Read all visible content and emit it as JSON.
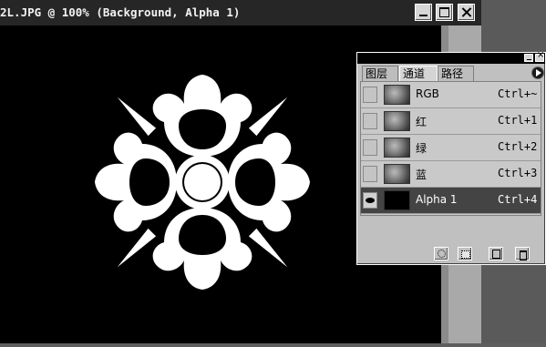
{
  "window": {
    "title": "2L.JPG @ 100% (Background, Alpha 1)"
  },
  "palette": {
    "tabs": [
      {
        "label": "图层"
      },
      {
        "label": "通道"
      },
      {
        "label": "路径"
      }
    ],
    "active_tab": "通道",
    "channels": [
      {
        "name": "RGB",
        "shortcut": "Ctrl+~",
        "visible": false,
        "active": false
      },
      {
        "name": "红",
        "shortcut": "Ctrl+1",
        "visible": false,
        "active": false
      },
      {
        "name": "绿",
        "shortcut": "Ctrl+2",
        "visible": false,
        "active": false
      },
      {
        "name": "蓝",
        "shortcut": "Ctrl+3",
        "visible": false,
        "active": false
      },
      {
        "name": "Alpha 1",
        "shortcut": "Ctrl+4",
        "visible": true,
        "active": true
      }
    ],
    "bottom_icons": [
      "load-selection-icon",
      "save-selection-icon",
      "new-channel-icon",
      "trash-icon"
    ]
  },
  "colors": {
    "canvas": "#000000",
    "shape": "#ffffff",
    "active_row": "#444444"
  }
}
